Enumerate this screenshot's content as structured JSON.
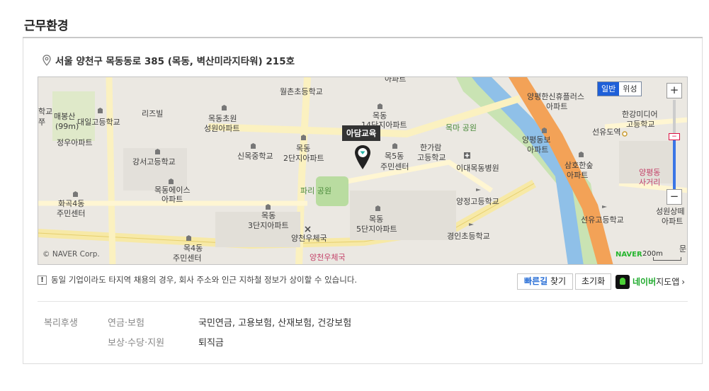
{
  "section": {
    "title": "근무환경"
  },
  "location": {
    "address": "서울 양천구 목동동로 385 (목동, 벽산미라지타워) 215호"
  },
  "map": {
    "marker_label": "아담교육",
    "map_type": {
      "normal": "일반",
      "satellite": "위성"
    },
    "zoom": {
      "in": "+",
      "out": "−",
      "handle": "−"
    },
    "copyright": "© NAVER Corp.",
    "brand": "NAVER",
    "scale": "200m",
    "labels": [
      "월촌초등학교",
      "아파트",
      "목동",
      "14단지아파트",
      "목마 공원",
      "양평한신휴플러스",
      "아파트",
      "한강미디어",
      "고등학교",
      "매봉산",
      "(99m)",
      "대일고등학교",
      "리즈빌",
      "목동초원",
      "성원아파트",
      "선유도역",
      "양평동보",
      "아파트",
      "정우아파트",
      "신목중학교",
      "목동",
      "2단지아파트",
      "목5동",
      "주민센터",
      "한가람",
      "고등학교",
      "이대목동병원",
      "삼호한숲",
      "아파트",
      "양평동",
      "사거리",
      "강서고등학교",
      "목동에이스",
      "아파트",
      "파리 공원",
      "화곡4동",
      "주민센터",
      "양정고등학교",
      "성원상떼",
      "아파트",
      "목동",
      "3단지아파트",
      "목동",
      "5단지아파트",
      "선유고등학교",
      "양천우체국",
      "경인초등학교",
      "목4동",
      "주민센터",
      "양천우체국",
      "문래",
      "쭈",
      "학교"
    ]
  },
  "notice": {
    "icon_text": "!",
    "text": "동일 기업이라도 타지역 채용의 경우, 회사 주소와 인근 지하철 정보가 상이할 수 있습니다."
  },
  "actions": {
    "route_blue": "빠른길",
    "route_rest": " 찾기",
    "reset": "초기화",
    "naver_app_green": "네이버",
    "naver_app_rest": "지도앱",
    "chevron": "›"
  },
  "benefits": {
    "heading": "복리후생",
    "rows": [
      {
        "label": "연금·보험",
        "value": "국민연금, 고용보험, 산재보험, 건강보험"
      },
      {
        "label": "보상·수당·지원",
        "value": "퇴직금"
      }
    ]
  },
  "colors": {
    "accent_blue": "#1e5fd8",
    "naver_green": "#25b52e",
    "river": "#6fa6dc",
    "expressway": "#f39a4a"
  }
}
